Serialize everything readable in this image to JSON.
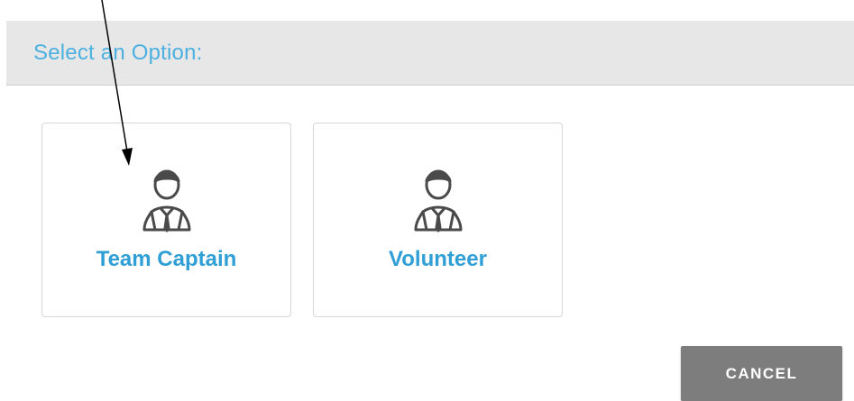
{
  "header": {
    "title": "Select an Option:"
  },
  "options": [
    {
      "label": "Team Captain",
      "icon": "user-icon"
    },
    {
      "label": "Volunteer",
      "icon": "user-icon"
    }
  ],
  "footer": {
    "cancel_label": "CANCEL"
  },
  "colors": {
    "accent": "#4cb0e0",
    "option_label": "#2f9fd6",
    "header_bg": "#e7e7e7",
    "button_bg": "#7d7d7d",
    "icon": "#4a4a4a"
  }
}
